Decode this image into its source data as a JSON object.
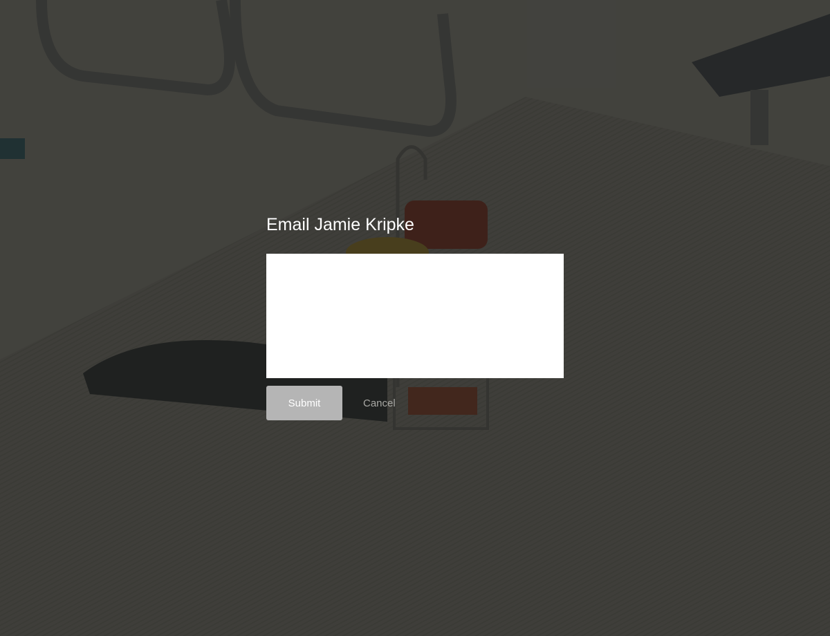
{
  "dialog": {
    "title": "Email Jamie Kripke",
    "message_value": "",
    "message_placeholder": "",
    "submit_label": "Submit",
    "cancel_label": "Cancel"
  },
  "colors": {
    "overlay": "#1c1c1a",
    "submit_background": "#b5b5b5",
    "cancel_text": "#a8a8a4",
    "title_text": "#ffffff"
  }
}
